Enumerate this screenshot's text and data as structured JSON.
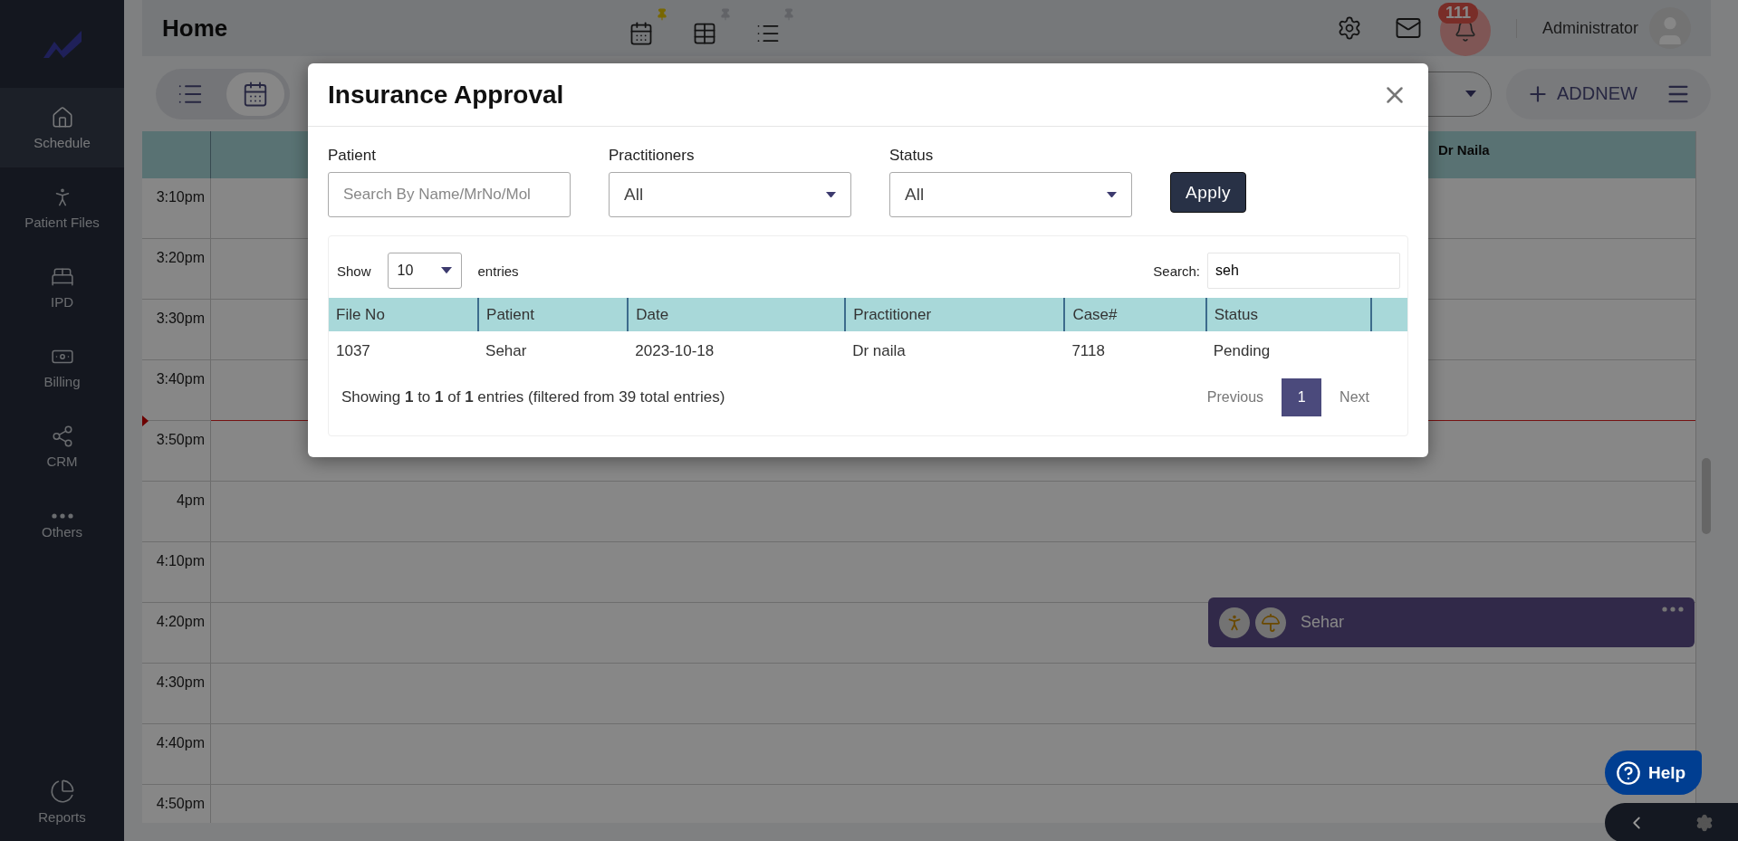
{
  "sidebar": {
    "items": [
      {
        "label": "Schedule",
        "selected": true
      },
      {
        "label": "Patient Files",
        "selected": false
      },
      {
        "label": "IPD",
        "selected": false
      },
      {
        "label": "Billing",
        "selected": false
      },
      {
        "label": "CRM",
        "selected": false
      },
      {
        "label": "Others",
        "selected": false
      }
    ],
    "footer_item": {
      "label": "Reports"
    }
  },
  "header": {
    "title": "Home",
    "view_shortcuts": [
      {
        "pinned": true
      },
      {
        "pinned": false
      },
      {
        "pinned": false
      }
    ],
    "notification_count": "111",
    "user": "Administrator"
  },
  "toolbar": {
    "view_toggles": [
      {
        "selected": false
      },
      {
        "selected": true
      }
    ],
    "add_button": "ADDNEW"
  },
  "calendar": {
    "column_header": "Dr Naila",
    "rows": [
      {
        "time": "3:10pm",
        "now": false
      },
      {
        "time": "3:20pm",
        "now": false
      },
      {
        "time": "3:30pm",
        "now": false
      },
      {
        "time": "3:40pm",
        "now": false
      },
      {
        "time": "3:50pm",
        "now": true
      },
      {
        "time": "4pm",
        "now": false
      },
      {
        "time": "4:10pm",
        "now": false
      },
      {
        "time": "4:20pm",
        "now": false,
        "appointments": [
          {
            "patient": "Sehar"
          }
        ]
      },
      {
        "time": "4:30pm",
        "now": false
      },
      {
        "time": "4:40pm",
        "now": false
      },
      {
        "time": "4:50pm",
        "now": false
      }
    ]
  },
  "modal": {
    "title": "Insurance Approval",
    "filters": {
      "patient": {
        "label": "Patient",
        "placeholder": "Search By Name/MrNo/Mol"
      },
      "practitioners": {
        "label": "Practitioners",
        "value": "All"
      },
      "status": {
        "label": "Status",
        "value": "All"
      },
      "apply": "Apply"
    },
    "table": {
      "show_label": "Show",
      "page_size": "10",
      "entries_label": "entries",
      "search_label": "Search:",
      "search_value": "seh",
      "columns": [
        "File No",
        "Patient",
        "Date",
        "Practitioner",
        "Case#",
        "Status"
      ],
      "rows": [
        [
          "1037",
          "Sehar",
          "2023-10-18",
          "Dr naila",
          "7118",
          "Pending"
        ]
      ],
      "info": "Showing **1** to **1** of **1** entries (filtered from 39 total entries)",
      "pagination": {
        "previous": "Previous",
        "pages": [
          {
            "label": "1",
            "selected": true
          }
        ],
        "next": "Next"
      }
    }
  },
  "help_button": "Help"
}
